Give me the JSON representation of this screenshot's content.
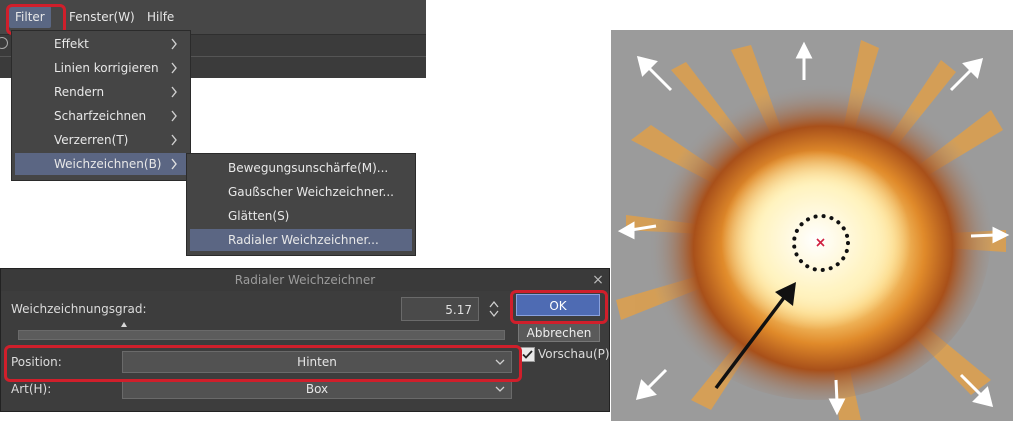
{
  "menubar": {
    "items": [
      {
        "label": "Filter"
      },
      {
        "label": "Fenster(W)"
      },
      {
        "label": "Hilfe"
      }
    ]
  },
  "filter_menu": {
    "items": [
      {
        "label": "Effekt"
      },
      {
        "label": "Linien korrigieren"
      },
      {
        "label": "Rendern"
      },
      {
        "label": "Scharfzeichnen"
      },
      {
        "label": "Verzerren(T)"
      },
      {
        "label": "Weichzeichnen(B)"
      }
    ],
    "selected": "Weichzeichnen(B)"
  },
  "blur_submenu": {
    "items": [
      {
        "label": "Bewegungsunschärfe(M)..."
      },
      {
        "label": "Gaußscher Weichzeichner..."
      },
      {
        "label": "Glätten(S)"
      },
      {
        "label": "Radialer Weichzeichner..."
      }
    ],
    "selected": "Radialer Weichzeichner..."
  },
  "dialog": {
    "title": "Radialer Weichzeichner",
    "close": "×",
    "strength_label": "Weichzeichnungsgrad:",
    "strength_value": "5.17",
    "ok": "OK",
    "cancel": "Abbrechen",
    "position_label": "Position:",
    "position_value": "Hinten",
    "preview_label": "Vorschau(P)",
    "preview_checked": true,
    "type_label": "Art(H):",
    "type_value": "Box"
  },
  "colors": {
    "highlight_border": "#d01f2b",
    "selection": "#5b6683",
    "ok_button": "#4e6bb3"
  }
}
